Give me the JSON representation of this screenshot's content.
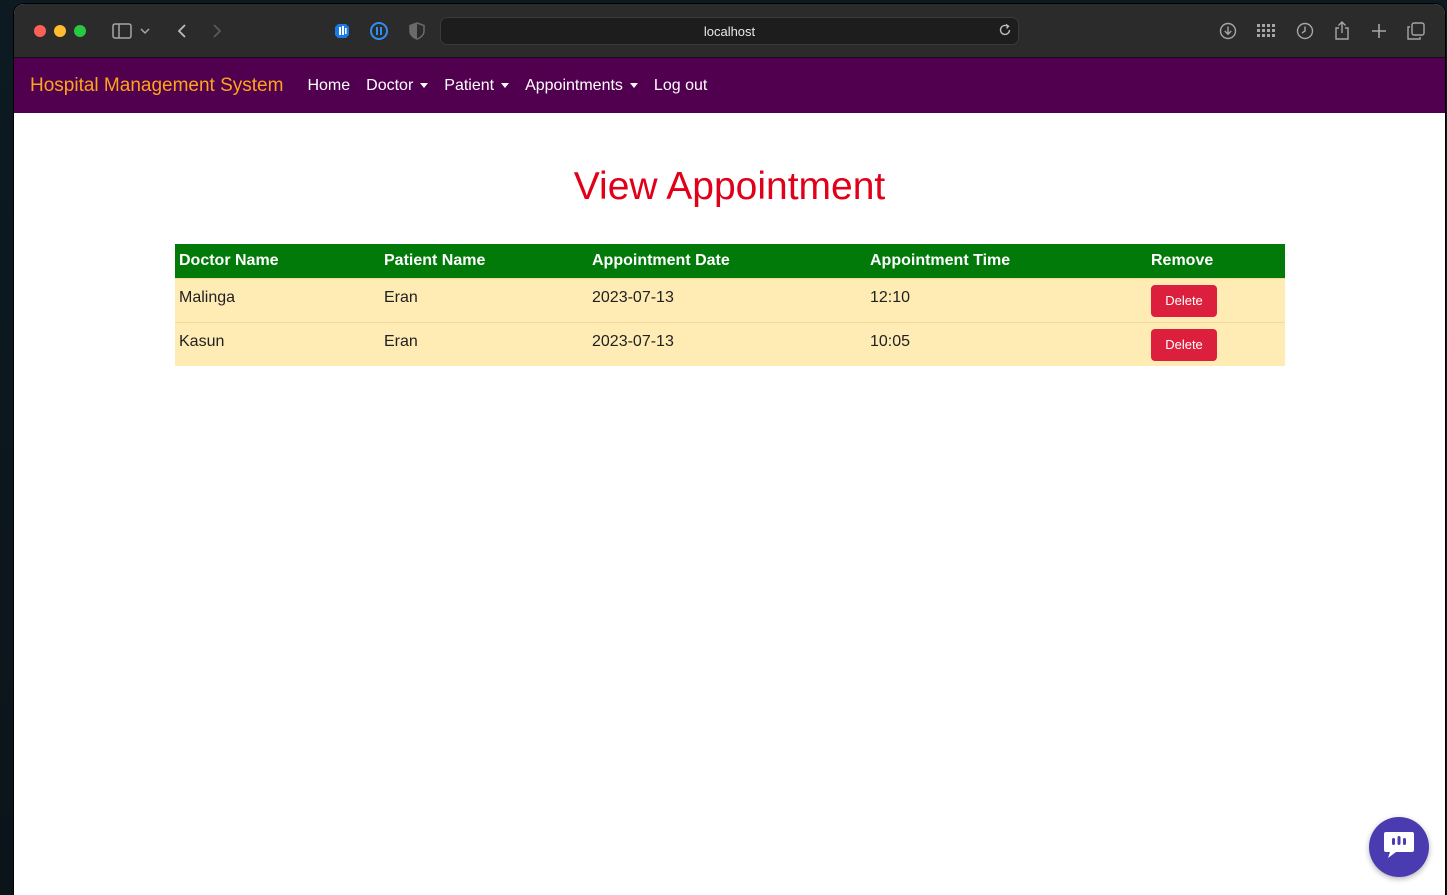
{
  "browser": {
    "url": "localhost"
  },
  "navbar": {
    "brand": "Hospital Management System",
    "items": [
      {
        "label": "Home",
        "dropdown": false
      },
      {
        "label": "Doctor",
        "dropdown": true
      },
      {
        "label": "Patient",
        "dropdown": true
      },
      {
        "label": "Appointments",
        "dropdown": true
      },
      {
        "label": "Log out",
        "dropdown": false
      }
    ]
  },
  "page": {
    "title": "View Appointment"
  },
  "table": {
    "headers": [
      "Doctor Name",
      "Patient Name",
      "Appointment Date",
      "Appointment Time",
      "Remove"
    ],
    "rows": [
      {
        "doctor": "Malinga",
        "patient": "Eran",
        "date": "2023-07-13",
        "time": "12:10",
        "action": "Delete"
      },
      {
        "doctor": "Kasun",
        "patient": "Eran",
        "date": "2023-07-13",
        "time": "10:05",
        "action": "Delete"
      }
    ]
  },
  "colors": {
    "navbar_bg": "#510050",
    "brand": "#ffa31a",
    "title": "#e0001a",
    "table_header": "#027a0a",
    "row_bg": "#ffecb5",
    "delete_button": "#dc1f3c"
  },
  "icons": {
    "chat": "chat-icon"
  }
}
